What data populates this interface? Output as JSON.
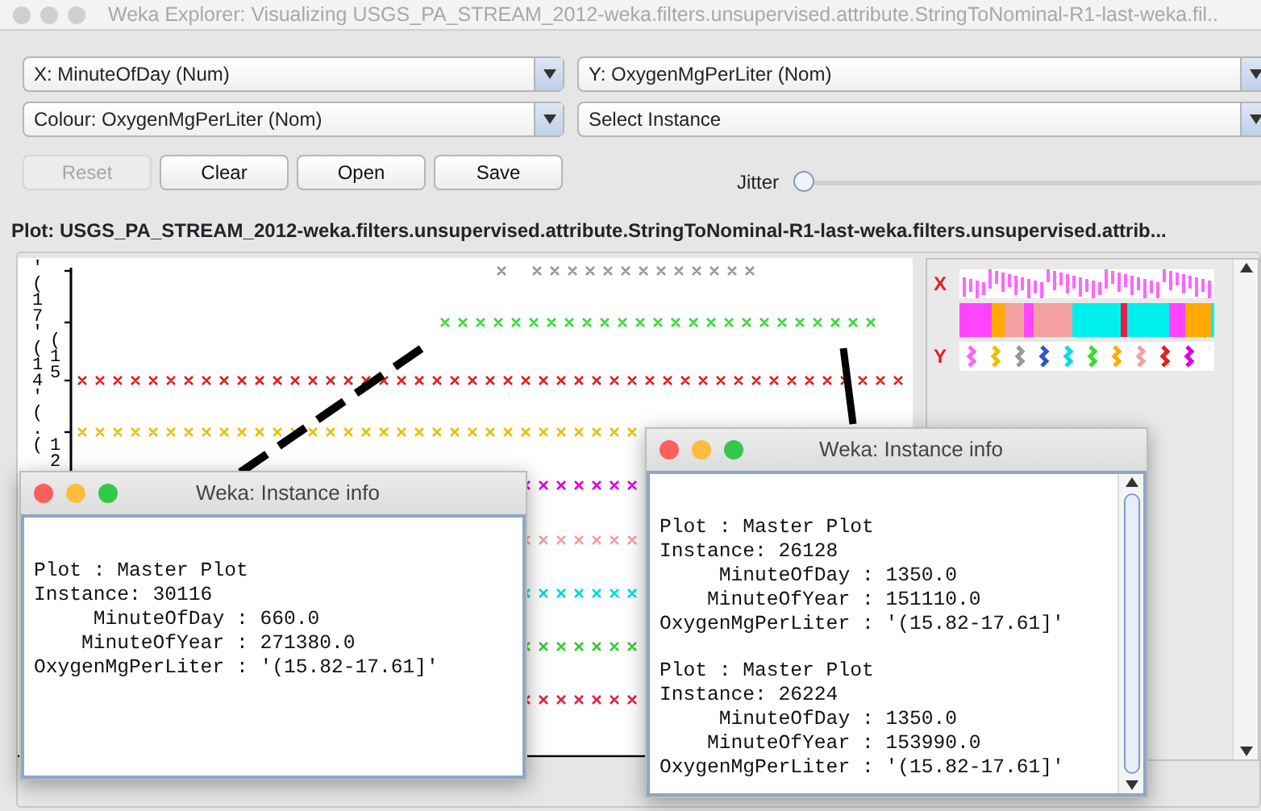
{
  "window": {
    "title": "Weka Explorer: Visualizing USGS_PA_STREAM_2012-weka.filters.unsupervised.attribute.StringToNominal-R1-last-weka.fil.."
  },
  "selectors": [
    {
      "label": "X: MinuteOfDay (Num)"
    },
    {
      "label": "Y: OxygenMgPerLiter (Nom)"
    },
    {
      "label": "Colour: OxygenMgPerLiter (Nom)"
    },
    {
      "label": "Select Instance"
    }
  ],
  "buttons": [
    {
      "label": "Reset",
      "disabled": true
    },
    {
      "label": "Clear",
      "disabled": false
    },
    {
      "label": "Open",
      "disabled": false
    },
    {
      "label": "Save",
      "disabled": false
    }
  ],
  "jitter": {
    "label": "Jitter",
    "level": 0
  },
  "plot": {
    "title": "Plot: USGS_PA_STREAM_2012-weka.filters.unsupervised.attribute.StringToNominal-R1-last-weka.filters.unsupervised.attrib...",
    "y_axis_labels": [
      "'(17'(14'(.(",
      "(15",
      "12"
    ],
    "point_rows": [
      {
        "color": "#999999"
      },
      {
        "color": "#33dd33"
      },
      {
        "color": "#e02020"
      },
      {
        "color": "#e8c000"
      },
      {
        "color": "#dd00dd"
      },
      {
        "color": "#f0a0a0"
      },
      {
        "color": "#00d8d8"
      },
      {
        "color": "#33cc33"
      },
      {
        "color": "#dd2244"
      }
    ]
  },
  "legend": {
    "x_label": "X",
    "y_label": "Y"
  },
  "info_windows": [
    {
      "title": "Weka: Instance info",
      "scrollbar": false,
      "records": [
        {
          "text": "Plot : Master Plot\nInstance: 30116\n     MinuteOfDay : 660.0\n    MinuteOfYear : 271380.0\nOxygenMgPerLiter : '(15.82-17.61]'"
        }
      ]
    },
    {
      "title": "Weka: Instance info",
      "scrollbar": true,
      "records": [
        {
          "text": "Plot : Master Plot\nInstance: 26128\n     MinuteOfDay : 1350.0\n    MinuteOfYear : 151110.0\nOxygenMgPerLiter : '(15.82-17.61]'"
        },
        {
          "text": "Plot : Master Plot\nInstance: 26224\n     MinuteOfDay : 1350.0\n    MinuteOfYear : 153990.0\nOxygenMgPerLiter : '(15.82-17.61]'"
        }
      ]
    }
  ]
}
